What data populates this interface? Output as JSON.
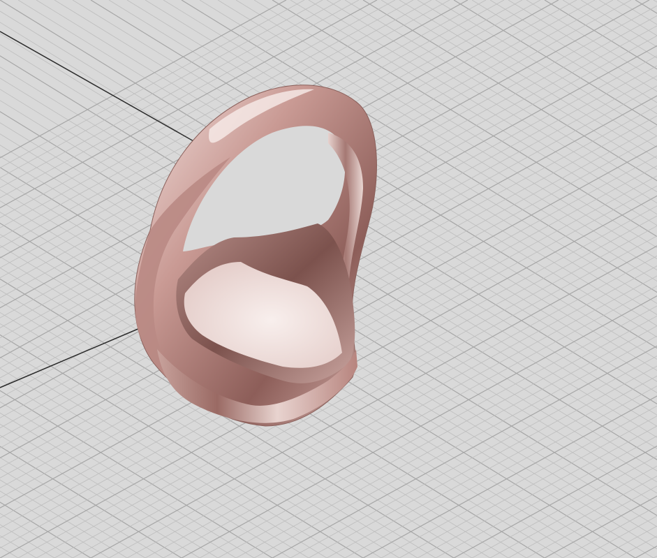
{
  "viewport": {
    "background_color": "#d9d9d9",
    "grid_minor_color": "#bdbdbd",
    "grid_major_color": "#a6a6a6",
    "axis_color": "#2b2b2b"
  },
  "model": {
    "material_color": "#d8b3ae",
    "highlight_color": "#f6e9e7",
    "shadow_color": "#7a4f4b"
  }
}
